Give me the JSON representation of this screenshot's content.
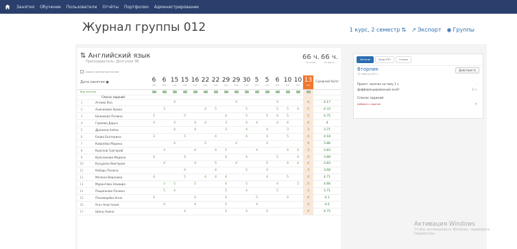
{
  "nav": {
    "items": [
      "Занятия",
      "Обучение",
      "Пользователи",
      "Отчёты",
      "Портфолио",
      "Администрирование"
    ]
  },
  "header": {
    "title": "Журнал группы 012",
    "course": "1 курс, 2 семестр",
    "export": "Экспорт",
    "groups": "Группы"
  },
  "subject": {
    "name": "Английский язык",
    "teacher": "Преподаватель: Долгунов ЗВ",
    "hours_plan": "66 ч.",
    "hours_plan_sub": "По плану",
    "hours_fact": "66 ч.",
    "hours_fact_sub": "По факту",
    "legend": "Скрыть полностью пустые"
  },
  "table": {
    "col_header": "Дата занятия",
    "avg_header": "Средний балл",
    "dates": [
      {
        "d": "6",
        "m": "мар"
      },
      {
        "d": "6",
        "m": "мар"
      },
      {
        "d": "15",
        "m": "мар"
      },
      {
        "d": "15",
        "m": "мар"
      },
      {
        "d": "16",
        "m": "мар"
      },
      {
        "d": "22",
        "m": "мар"
      },
      {
        "d": "22",
        "m": "мар"
      },
      {
        "d": "29",
        "m": "мар"
      },
      {
        "d": "29",
        "m": "мар"
      },
      {
        "d": "30",
        "m": "мар"
      },
      {
        "d": "5",
        "m": "апр"
      },
      {
        "d": "5",
        "m": "апр"
      },
      {
        "d": "6",
        "m": "апр"
      },
      {
        "d": "10",
        "m": "апр"
      },
      {
        "d": "10",
        "m": "апр"
      },
      {
        "d": "13",
        "m": "апр"
      }
    ],
    "row_type_label": "Вид занятия",
    "row_hw_label": "Список заданий",
    "students": [
      {
        "n": "1",
        "name": "Агеева Яна",
        "g": [
          "",
          "",
          "4",
          "",
          "",
          "",
          "",
          "",
          "4",
          "",
          "",
          "",
          "4",
          "",
          "",
          "4"
        ],
        "avg": "4.17"
      },
      {
        "n": "2",
        "name": "Анисимова Арина",
        "g": [
          "",
          "3",
          "",
          "",
          "",
          "4",
          "5",
          "",
          "",
          "5",
          "",
          "",
          "5",
          "5",
          "4",
          "5"
        ],
        "avg": "4.33"
      },
      {
        "n": "3",
        "name": "Бажакова Полина",
        "g": [
          "5",
          "",
          "",
          "5",
          "",
          "",
          "",
          "4",
          "",
          "5",
          "",
          "5",
          "4",
          "5",
          "",
          "5"
        ],
        "avg": "4.75"
      },
      {
        "n": "4",
        "name": "Гареева Дарья",
        "g": [
          "4",
          "",
          "3",
          "",
          "4",
          "4",
          "",
          "3",
          "",
          "4",
          "4",
          "",
          "4",
          "4",
          "",
          "4"
        ],
        "avg": "4"
      },
      {
        "n": "5",
        "name": "Дронина Алёна",
        "g": [
          "",
          "",
          "4",
          "",
          "4",
          "",
          "",
          "3",
          "",
          "4",
          "",
          "4",
          "",
          "3",
          "",
          "3"
        ],
        "avg": "3.71"
      },
      {
        "n": "6",
        "name": "Елова Екатерина",
        "g": [
          "3",
          "",
          "",
          "5",
          "",
          "",
          "4",
          "",
          "",
          "4",
          "",
          "4",
          "",
          "5",
          "",
          "4"
        ],
        "avg": "4.18"
      },
      {
        "n": "7",
        "name": "Ковалёва Марина",
        "g": [
          "",
          "",
          "4",
          "",
          "",
          "5",
          "",
          "",
          "4",
          "",
          "",
          "4",
          "",
          "",
          "",
          "4"
        ],
        "avg": "3.86"
      },
      {
        "n": "8",
        "name": "Краснов Григорий",
        "g": [
          "",
          "3",
          "",
          "",
          "4",
          "",
          "4",
          "5",
          "",
          "",
          "4",
          "",
          "",
          "4",
          "4",
          "3"
        ],
        "avg": "3.83"
      },
      {
        "n": "9",
        "name": "Красникова Марина",
        "g": [
          "4",
          "",
          "",
          "4",
          "",
          "",
          "",
          "4",
          "",
          "4",
          "",
          "",
          "5",
          "",
          "4",
          "4"
        ],
        "avg": "3.88"
      },
      {
        "n": "10",
        "name": "Кукуреко Виктория",
        "g": [
          "",
          "4",
          "",
          "",
          "4",
          "",
          "5",
          "",
          "4",
          "",
          "",
          "5",
          "",
          "4",
          "4",
          "4"
        ],
        "avg": "3.83"
      },
      {
        "n": "11",
        "name": "Кобарь Полина",
        "g": [
          "",
          "",
          "",
          "4",
          "",
          "",
          "4",
          "",
          "",
          "5",
          "",
          "4",
          "",
          "",
          "",
          "3"
        ],
        "avg": "3.68"
      },
      {
        "n": "12",
        "name": "Мелина Вероника",
        "g": [
          "4",
          "",
          "",
          "5",
          "",
          "4",
          "4",
          "4",
          "",
          "",
          "",
          "4",
          "",
          "5",
          "",
          "4"
        ],
        "avg": "4.71"
      },
      {
        "n": "13",
        "name": "Мурантова Эльвира",
        "g": [
          "",
          "3",
          "5",
          "",
          "5",
          "",
          "",
          "4",
          "",
          "5",
          "",
          "",
          "4",
          "",
          "5",
          "5"
        ],
        "avg": "4.66"
      },
      {
        "n": "14",
        "name": "Пащенкова Полина",
        "g": [
          "",
          "5",
          "4",
          "",
          "",
          "",
          "",
          "5",
          "",
          "4",
          "",
          "",
          "5",
          "",
          "",
          "3"
        ],
        "avg": "3.71"
      },
      {
        "n": "15",
        "name": "Пономарёва Анна",
        "g": [
          "4",
          "",
          "",
          "",
          "4",
          "",
          "",
          "4",
          "",
          "",
          "5",
          "",
          "",
          "4",
          "",
          "4"
        ],
        "avg": "4.1"
      },
      {
        "n": "16",
        "name": "Усач Анастасия",
        "g": [
          "",
          "4",
          "",
          "",
          "4",
          "",
          "",
          "5",
          "",
          "",
          "4",
          "",
          "",
          "",
          "",
          "4"
        ],
        "avg": "4.2"
      },
      {
        "n": "17",
        "name": "Шанц Алина",
        "g": [
          "",
          "",
          "",
          "4",
          "",
          "",
          "",
          "5",
          "",
          "4",
          "",
          "4",
          "",
          "",
          "",
          "4"
        ],
        "avg": "4.75"
      }
    ]
  },
  "sidebar": {
    "tabs": [
      "Занятие",
      "Вход ЕПП",
      "Список"
    ],
    "day": "Вторник",
    "date": "13 апреля 2021 г.",
    "actions": "Действия",
    "lines": [
      {
        "label": "Проект: занятие на тему 1 ч.",
        "value": "-"
      },
      {
        "label": "Дифференцированный зачёт",
        "value": "1 ч."
      }
    ],
    "tasks_title": "Список заданий",
    "tasks_link": "Добавить задание",
    "delete": "×"
  },
  "watermark": {
    "line1": "Активация Windows",
    "line2": "Чтобы активировать Windows, перейдите",
    "line3": "Параметры"
  },
  "colors": {
    "nav": "#2a3f6b",
    "accent": "#2b6cb0",
    "highlight": "#f0752d",
    "grade": "#5a9b4f"
  }
}
